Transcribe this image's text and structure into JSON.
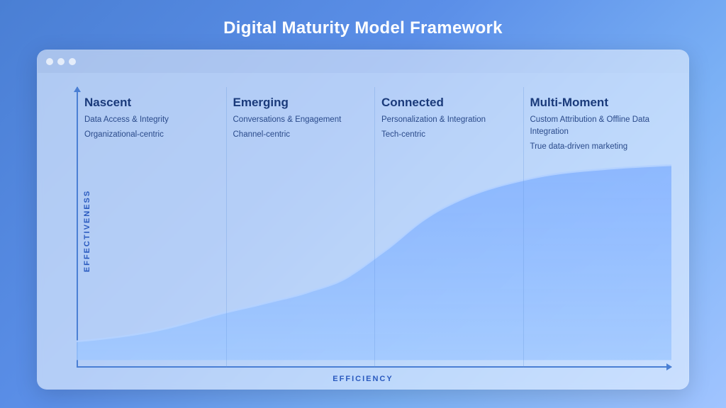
{
  "page": {
    "title": "Digital Maturity Model Framework",
    "background": "#5082d8"
  },
  "browser": {
    "dots": [
      "dot1",
      "dot2",
      "dot3"
    ]
  },
  "axes": {
    "y_label": "EFFECTIVENESS",
    "x_label": "EFFICIENCY"
  },
  "stages": [
    {
      "id": "nascent",
      "title": "Nascent",
      "bullets": [
        "Data Access & Integrity",
        "Organizational-centric"
      ]
    },
    {
      "id": "emerging",
      "title": "Emerging",
      "bullets": [
        "Conversations & Engagement",
        "Channel-centric"
      ]
    },
    {
      "id": "connected",
      "title": "Connected",
      "bullets": [
        "Personalization & Integration",
        "Tech-centric"
      ]
    },
    {
      "id": "multi-moment",
      "title": "Multi-Moment",
      "bullets": [
        "Custom Attribution & Offline Data Integration",
        "True data-driven marketing"
      ]
    }
  ]
}
